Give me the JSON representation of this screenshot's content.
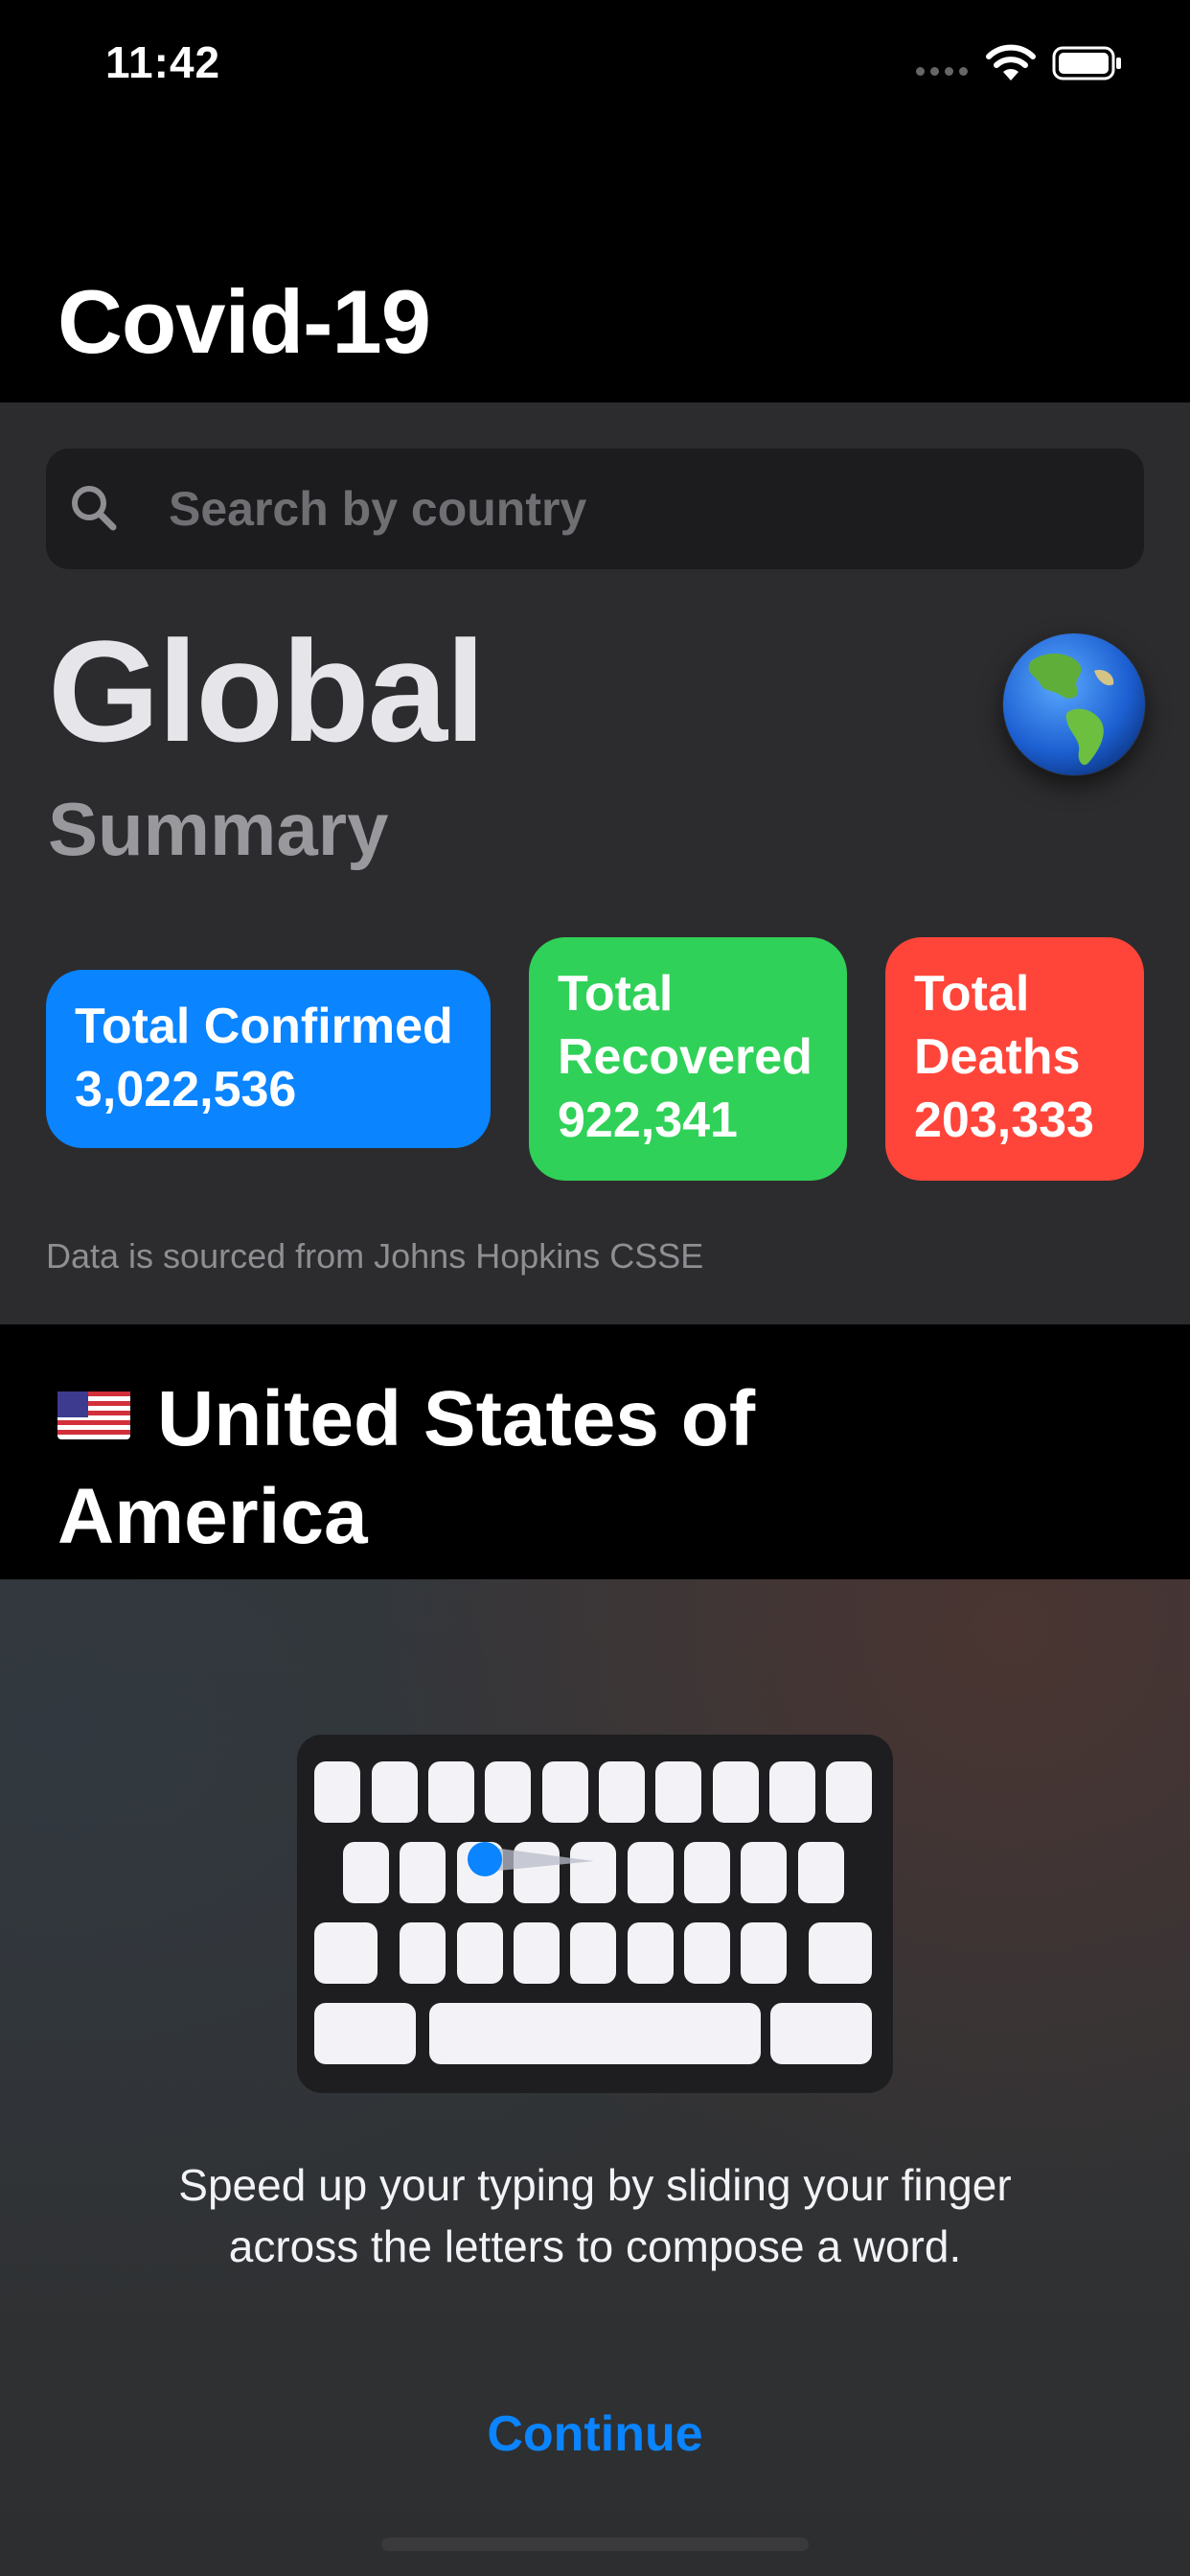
{
  "status_bar": {
    "time": "11:42"
  },
  "header": {
    "title": "Covid-19"
  },
  "search": {
    "placeholder": "Search by country"
  },
  "global": {
    "title": "Global",
    "subtitle": "Summary"
  },
  "cards": {
    "confirmed": {
      "label": "Total Confirmed",
      "value": "3,022,536",
      "color": "#0a84ff"
    },
    "recovered": {
      "label_line1": "Total",
      "label_line2": "Recovered",
      "value": "922,341",
      "color": "#30d158"
    },
    "deaths": {
      "label_line1": "Total",
      "label_line2": "Deaths",
      "value": "203,333",
      "color": "#ff453a"
    }
  },
  "source_note": "Data is sourced from Johns Hopkins CSSE",
  "country": {
    "line1": "United States of",
    "line2": "America",
    "flag_icon": "us-flag-icon"
  },
  "sheet": {
    "instruction_line1": "Speed up your typing by sliding your finger",
    "instruction_line2": "across the letters to compose a word.",
    "continue_label": "Continue"
  }
}
